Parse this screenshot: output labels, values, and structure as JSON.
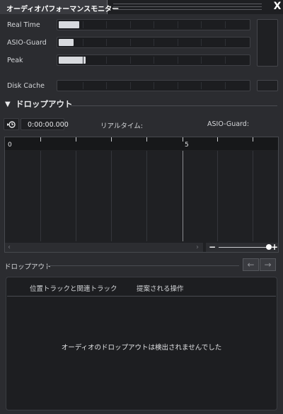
{
  "window": {
    "title": "オーディオパフォーマンスモニター",
    "close_label": "X"
  },
  "meters": {
    "real_time": {
      "label": "Real Time",
      "value": 0.11
    },
    "asio_guard": {
      "label": "ASIO-Guard",
      "value": 0.08
    },
    "peak": {
      "label": "Peak",
      "value": 0.14
    },
    "disk_cache": {
      "label": "Disk Cache",
      "value": 0.0
    }
  },
  "dropout_section": {
    "title": "ドロップアウト",
    "time": "0:00:00.000",
    "realtime_label": "リアルタイム:",
    "asio_guard_label": "ASIO-Guard:",
    "ruler_labels": [
      "0",
      "5"
    ]
  },
  "dropout_list": {
    "label": "ドロップアウト",
    "columns": [
      "位置トラックと関連トラック",
      "提案される操作"
    ],
    "empty_message": "オーディオのドロップアウトは検出されませんでした",
    "prev_icon": "←",
    "next_icon": "→"
  }
}
